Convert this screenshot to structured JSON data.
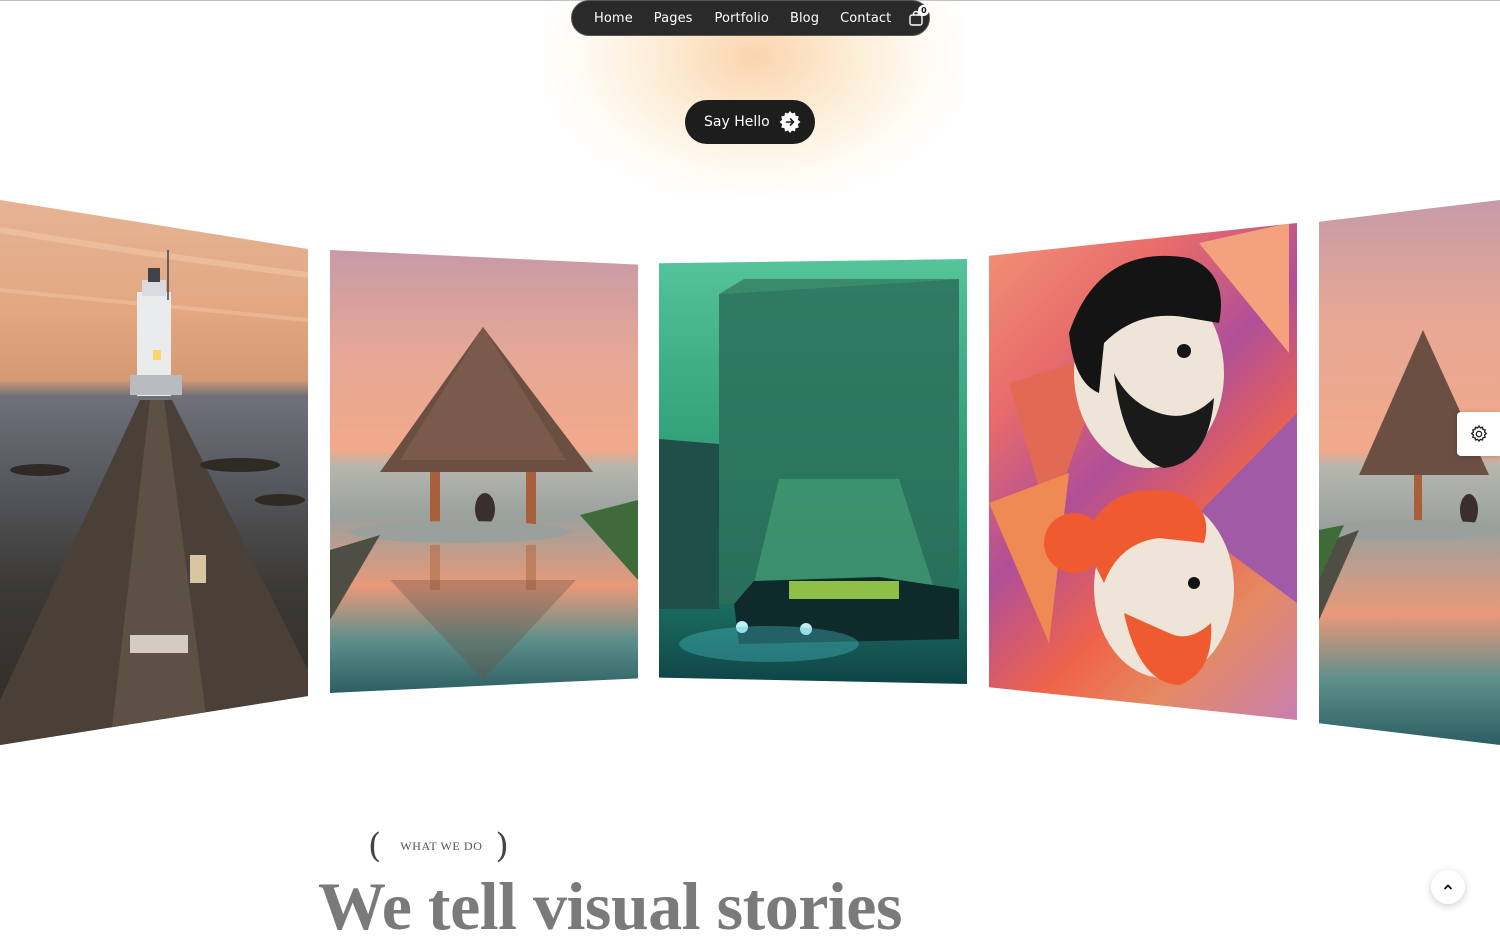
{
  "nav": {
    "links": [
      "Home",
      "Pages",
      "Portfolio",
      "Blog",
      "Contact"
    ],
    "cart_icon": "shopping-bag-icon",
    "cart_count": "0"
  },
  "cta": {
    "label": "Say Hello",
    "icon": "arrow-badge-icon"
  },
  "gallery": {
    "items": [
      {
        "subject": "lighthouse-pier"
      },
      {
        "subject": "thatched-hut-pool"
      },
      {
        "subject": "green-building-car"
      },
      {
        "subject": "two-bearded-men-illustration"
      },
      {
        "subject": "thatched-hut-pool"
      }
    ]
  },
  "section": {
    "label": "WHAT WE DO",
    "heading": "We tell visual stories"
  },
  "widgets": {
    "settings_icon": "gear-icon",
    "scroll_top_icon": "chevron-up-icon"
  },
  "colors": {
    "nav_bg": "#2a2a2a",
    "cta_bg": "#1d1d1d",
    "heading": "#7a7a7a"
  }
}
